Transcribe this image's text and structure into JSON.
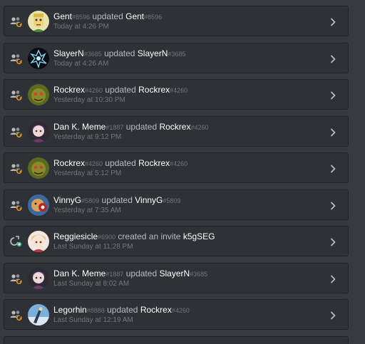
{
  "entries": [
    {
      "kind": "update",
      "user": "Gent",
      "user_disc": "#8596",
      "verb": "updated",
      "target": "Gent",
      "target_disc": "#8596",
      "time": "Today at 4:26 PM",
      "avatar": "gent-avatar"
    },
    {
      "kind": "update",
      "user": "SlayerN",
      "user_disc": "#3685",
      "verb": "updated",
      "target": "SlayerN",
      "target_disc": "#3685",
      "time": "Today at 4:26 AM",
      "avatar": "slayern-avatar"
    },
    {
      "kind": "update",
      "user": "Rockrex",
      "user_disc": "#4260",
      "verb": "updated",
      "target": "Rockrex",
      "target_disc": "#4260",
      "time": "Yesterday at 10:30 PM",
      "avatar": "rockrex-avatar"
    },
    {
      "kind": "update",
      "user": "Dan K. Meme",
      "user_disc": "#1887",
      "verb": "updated",
      "target": "Rockrex",
      "target_disc": "#4260",
      "time": "Yesterday at 9:12 PM",
      "avatar": "dankmeme-avatar"
    },
    {
      "kind": "update",
      "user": "Rockrex",
      "user_disc": "#4260",
      "verb": "updated",
      "target": "Rockrex",
      "target_disc": "#4260",
      "time": "Yesterday at 5:12 PM",
      "avatar": "rockrex-avatar"
    },
    {
      "kind": "update",
      "user": "VinnyG",
      "user_disc": "#5809",
      "verb": "updated",
      "target": "VinnyG",
      "target_disc": "#5809",
      "time": "Yesterday at 7:35 AM",
      "avatar": "vinnyg-avatar"
    },
    {
      "kind": "invite",
      "user": "Reggiesicle",
      "user_disc": "#6900",
      "verb": "created an invite",
      "target": "k5gSEG",
      "target_disc": "",
      "time": "Last Sunday at 11:28 PM",
      "avatar": "reggiesicle-avatar"
    },
    {
      "kind": "update",
      "user": "Dan K. Meme",
      "user_disc": "#1887",
      "verb": "updated",
      "target": "SlayerN",
      "target_disc": "#3685",
      "time": "Last Sunday at 8:02 AM",
      "avatar": "dankmeme-avatar"
    },
    {
      "kind": "update",
      "user": "Legorhin",
      "user_disc": "#8888",
      "verb": "updated",
      "target": "Rockrex",
      "target_disc": "#4260",
      "time": "Last Sunday at 12:19 AM",
      "avatar": "legorhin-avatar"
    }
  ],
  "colors": {
    "background": "#36393f",
    "row": "#2f3136",
    "text": "#dcddde",
    "muted": "#72767d",
    "icon": "#b9bbbe",
    "invite_icon": "#43b581"
  },
  "icons": {
    "member_update": "member-update-icon",
    "invite_create": "invite-create-icon",
    "expand": "chevron-right-icon"
  }
}
